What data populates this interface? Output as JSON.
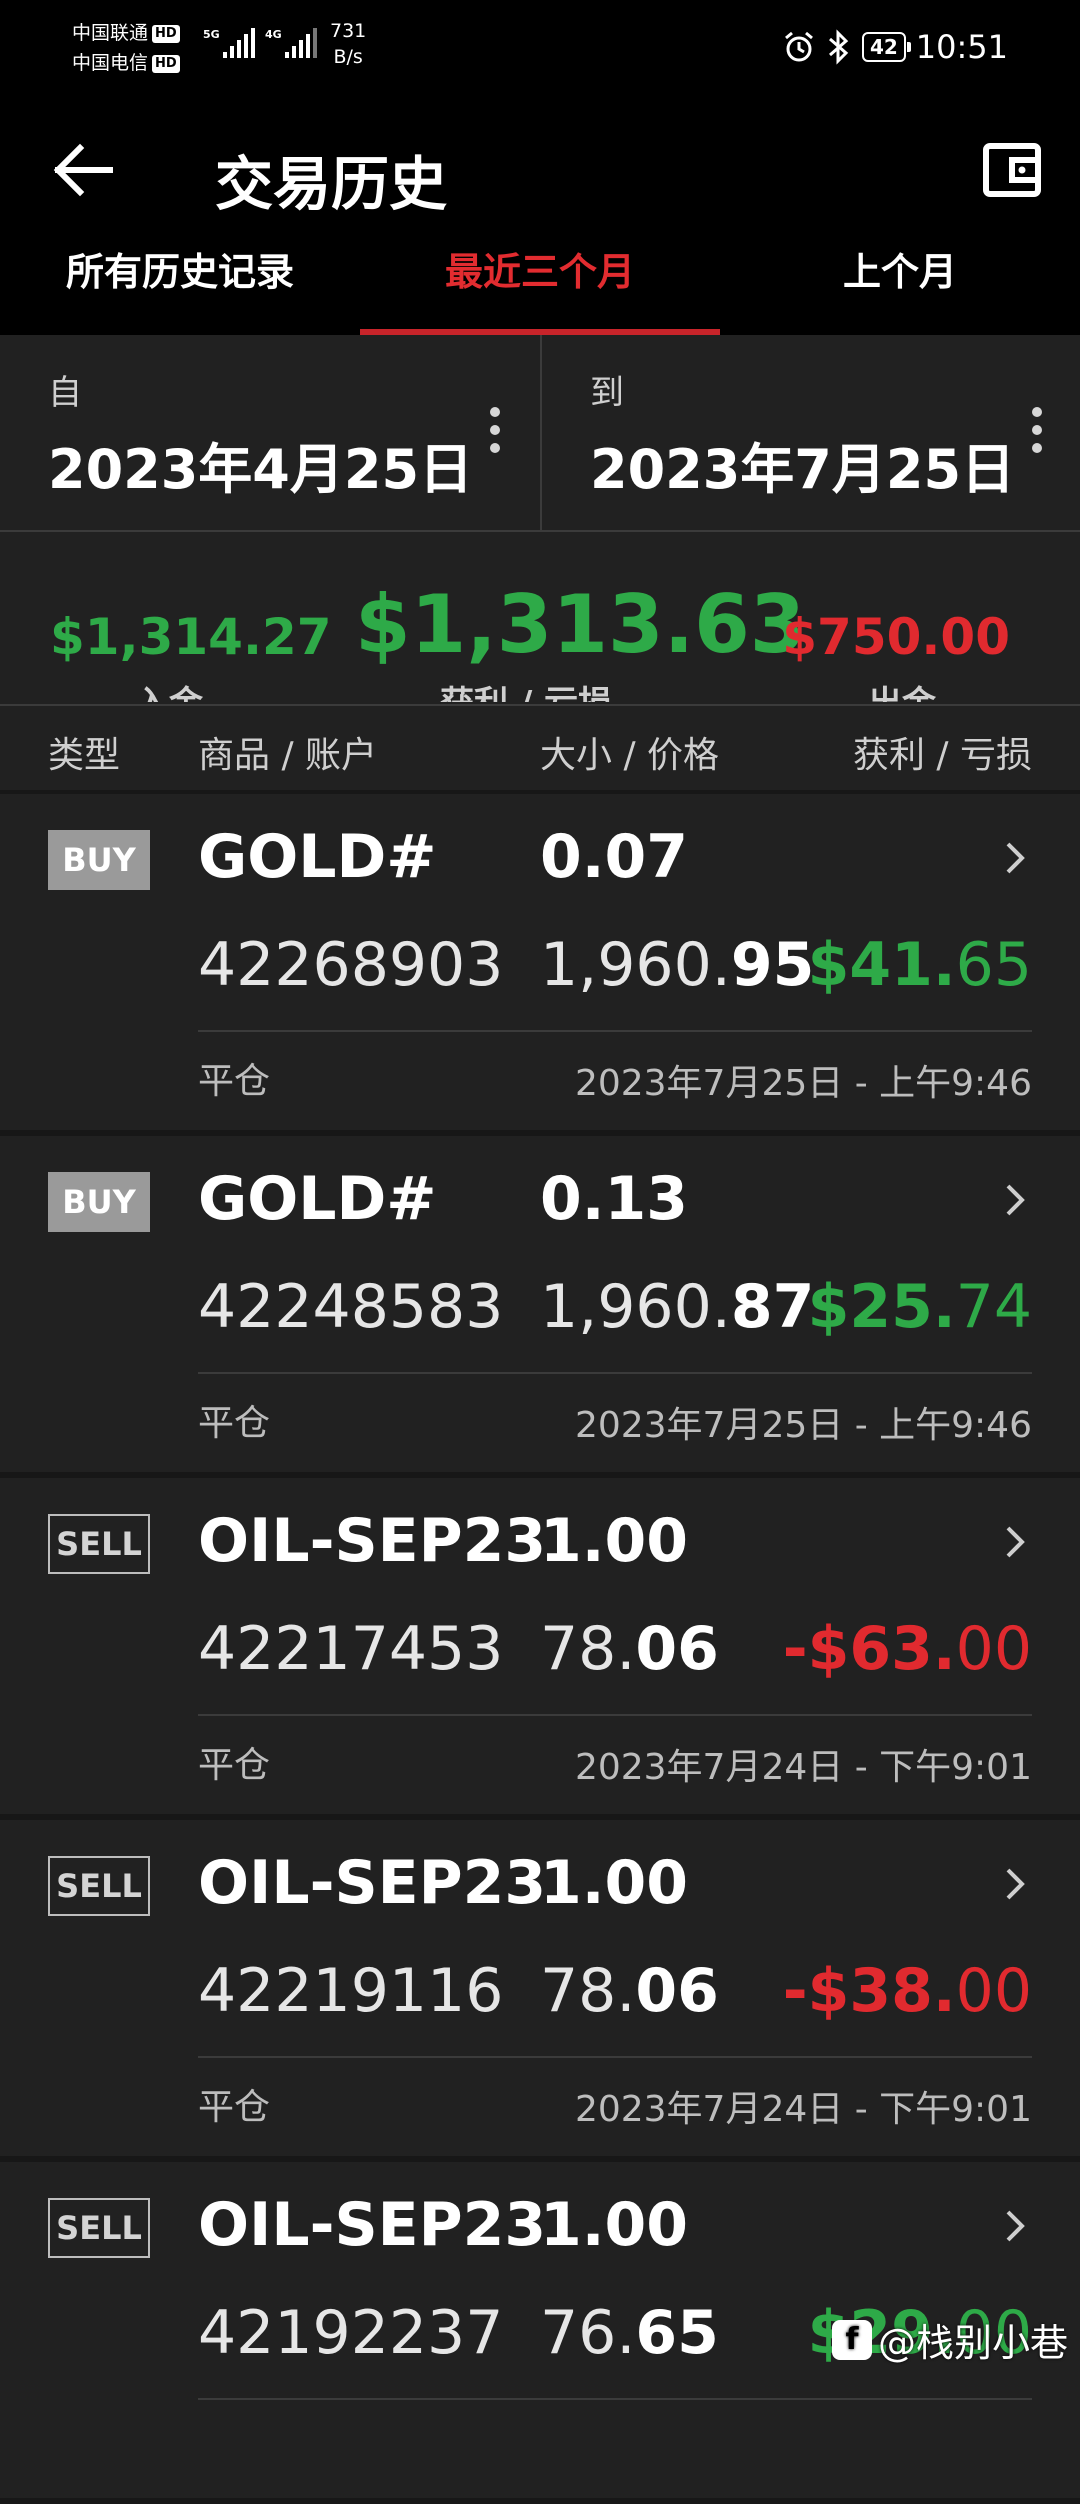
{
  "status_bar": {
    "carrier1": "中国联通",
    "carrier2": "中国电信",
    "hd": "HD",
    "net_speed_value": "731",
    "net_speed_unit": "B/s",
    "battery": "42",
    "time": "10:51"
  },
  "header": {
    "title": "交易历史",
    "back_icon": "arrow-left-icon",
    "wallet_icon": "wallet-icon"
  },
  "tabs": [
    {
      "label": "所有历史记录",
      "active": false
    },
    {
      "label": "最近三个月",
      "active": true
    },
    {
      "label": "上个月",
      "active": false
    }
  ],
  "date_range": {
    "from_label": "自",
    "from_value": "2023年4月25日",
    "to_label": "到",
    "to_value": "2023年7月25日"
  },
  "summary": {
    "deposit_value": "$1,314.27",
    "deposit_label": "入金",
    "profit_value": "$1,313.63",
    "profit_label": "获利 / 亏损",
    "withdraw_value": "$750.00",
    "withdraw_label": "出金"
  },
  "columns": {
    "type": "类型",
    "symbol_account": "商品 / 账户",
    "size_price": "大小 / 价格",
    "profit_loss": "获利 / 亏损"
  },
  "trades": [
    {
      "type": "BUY",
      "symbol": "GOLD#",
      "volume": "0.07",
      "ticket": "42268903",
      "price_main": "1,960.",
      "price_tail": "95",
      "profit_main": "$41.",
      "profit_cents": "65",
      "profit_sign": "positive",
      "state": "平仓",
      "time": "2023年7月25日 - 上午9:46"
    },
    {
      "type": "BUY",
      "symbol": "GOLD#",
      "volume": "0.13",
      "ticket": "42248583",
      "price_main": "1,960.",
      "price_tail": "87",
      "profit_main": "$25.",
      "profit_cents": "74",
      "profit_sign": "positive",
      "state": "平仓",
      "time": "2023年7月25日 - 上午9:46"
    },
    {
      "type": "SELL",
      "symbol": "OIL-SEP23",
      "volume": "1.00",
      "ticket": "42217453",
      "price_main": "78.",
      "price_tail": "06",
      "profit_main": "-$63.",
      "profit_cents": "00",
      "profit_sign": "negative",
      "state": "平仓",
      "time": "2023年7月24日 - 下午9:01"
    },
    {
      "type": "SELL",
      "symbol": "OIL-SEP23",
      "volume": "1.00",
      "ticket": "42219116",
      "price_main": "78.",
      "price_tail": "06",
      "profit_main": "-$38.",
      "profit_cents": "00",
      "profit_sign": "negative",
      "state": "平仓",
      "time": "2023年7月24日 - 下午9:01"
    },
    {
      "type": "SELL",
      "symbol": "OIL-SEP23",
      "volume": "1.00",
      "ticket": "42192237",
      "price_main": "76.",
      "price_tail": "65",
      "profit_main": "$29.",
      "profit_cents": "00",
      "profit_sign": "positive",
      "state": "",
      "time": ""
    }
  ],
  "watermark": {
    "logo": "f",
    "text": "@栈别小巷"
  },
  "colors": {
    "accent_red": "#e12a2f",
    "profit_green": "#2eaa48",
    "background": "#212121",
    "header_bg": "#000000"
  }
}
